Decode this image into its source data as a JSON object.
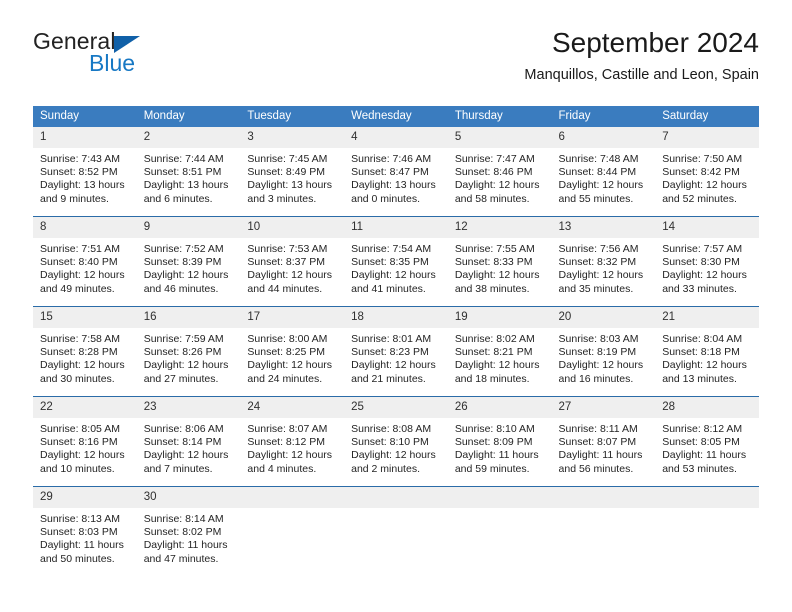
{
  "logo": {
    "word1": "General",
    "word2": "Blue",
    "triangle_color": "#1060a8",
    "blue_color": "#1778c4"
  },
  "header": {
    "title": "September 2024",
    "subtitle": "Manquillos, Castille and Leon, Spain"
  },
  "theme": {
    "header_bg": "#3a7cbf",
    "row_border": "#2b6ca8",
    "daynum_bg": "#efefef"
  },
  "calendar": {
    "weekday_headers": [
      "Sunday",
      "Monday",
      "Tuesday",
      "Wednesday",
      "Thursday",
      "Friday",
      "Saturday"
    ],
    "weeks": [
      [
        {
          "day": "1",
          "sunrise": "Sunrise: 7:43 AM",
          "sunset": "Sunset: 8:52 PM",
          "daylight1": "Daylight: 13 hours",
          "daylight2": "and 9 minutes."
        },
        {
          "day": "2",
          "sunrise": "Sunrise: 7:44 AM",
          "sunset": "Sunset: 8:51 PM",
          "daylight1": "Daylight: 13 hours",
          "daylight2": "and 6 minutes."
        },
        {
          "day": "3",
          "sunrise": "Sunrise: 7:45 AM",
          "sunset": "Sunset: 8:49 PM",
          "daylight1": "Daylight: 13 hours",
          "daylight2": "and 3 minutes."
        },
        {
          "day": "4",
          "sunrise": "Sunrise: 7:46 AM",
          "sunset": "Sunset: 8:47 PM",
          "daylight1": "Daylight: 13 hours",
          "daylight2": "and 0 minutes."
        },
        {
          "day": "5",
          "sunrise": "Sunrise: 7:47 AM",
          "sunset": "Sunset: 8:46 PM",
          "daylight1": "Daylight: 12 hours",
          "daylight2": "and 58 minutes."
        },
        {
          "day": "6",
          "sunrise": "Sunrise: 7:48 AM",
          "sunset": "Sunset: 8:44 PM",
          "daylight1": "Daylight: 12 hours",
          "daylight2": "and 55 minutes."
        },
        {
          "day": "7",
          "sunrise": "Sunrise: 7:50 AM",
          "sunset": "Sunset: 8:42 PM",
          "daylight1": "Daylight: 12 hours",
          "daylight2": "and 52 minutes."
        }
      ],
      [
        {
          "day": "8",
          "sunrise": "Sunrise: 7:51 AM",
          "sunset": "Sunset: 8:40 PM",
          "daylight1": "Daylight: 12 hours",
          "daylight2": "and 49 minutes."
        },
        {
          "day": "9",
          "sunrise": "Sunrise: 7:52 AM",
          "sunset": "Sunset: 8:39 PM",
          "daylight1": "Daylight: 12 hours",
          "daylight2": "and 46 minutes."
        },
        {
          "day": "10",
          "sunrise": "Sunrise: 7:53 AM",
          "sunset": "Sunset: 8:37 PM",
          "daylight1": "Daylight: 12 hours",
          "daylight2": "and 44 minutes."
        },
        {
          "day": "11",
          "sunrise": "Sunrise: 7:54 AM",
          "sunset": "Sunset: 8:35 PM",
          "daylight1": "Daylight: 12 hours",
          "daylight2": "and 41 minutes."
        },
        {
          "day": "12",
          "sunrise": "Sunrise: 7:55 AM",
          "sunset": "Sunset: 8:33 PM",
          "daylight1": "Daylight: 12 hours",
          "daylight2": "and 38 minutes."
        },
        {
          "day": "13",
          "sunrise": "Sunrise: 7:56 AM",
          "sunset": "Sunset: 8:32 PM",
          "daylight1": "Daylight: 12 hours",
          "daylight2": "and 35 minutes."
        },
        {
          "day": "14",
          "sunrise": "Sunrise: 7:57 AM",
          "sunset": "Sunset: 8:30 PM",
          "daylight1": "Daylight: 12 hours",
          "daylight2": "and 33 minutes."
        }
      ],
      [
        {
          "day": "15",
          "sunrise": "Sunrise: 7:58 AM",
          "sunset": "Sunset: 8:28 PM",
          "daylight1": "Daylight: 12 hours",
          "daylight2": "and 30 minutes."
        },
        {
          "day": "16",
          "sunrise": "Sunrise: 7:59 AM",
          "sunset": "Sunset: 8:26 PM",
          "daylight1": "Daylight: 12 hours",
          "daylight2": "and 27 minutes."
        },
        {
          "day": "17",
          "sunrise": "Sunrise: 8:00 AM",
          "sunset": "Sunset: 8:25 PM",
          "daylight1": "Daylight: 12 hours",
          "daylight2": "and 24 minutes."
        },
        {
          "day": "18",
          "sunrise": "Sunrise: 8:01 AM",
          "sunset": "Sunset: 8:23 PM",
          "daylight1": "Daylight: 12 hours",
          "daylight2": "and 21 minutes."
        },
        {
          "day": "19",
          "sunrise": "Sunrise: 8:02 AM",
          "sunset": "Sunset: 8:21 PM",
          "daylight1": "Daylight: 12 hours",
          "daylight2": "and 18 minutes."
        },
        {
          "day": "20",
          "sunrise": "Sunrise: 8:03 AM",
          "sunset": "Sunset: 8:19 PM",
          "daylight1": "Daylight: 12 hours",
          "daylight2": "and 16 minutes."
        },
        {
          "day": "21",
          "sunrise": "Sunrise: 8:04 AM",
          "sunset": "Sunset: 8:18 PM",
          "daylight1": "Daylight: 12 hours",
          "daylight2": "and 13 minutes."
        }
      ],
      [
        {
          "day": "22",
          "sunrise": "Sunrise: 8:05 AM",
          "sunset": "Sunset: 8:16 PM",
          "daylight1": "Daylight: 12 hours",
          "daylight2": "and 10 minutes."
        },
        {
          "day": "23",
          "sunrise": "Sunrise: 8:06 AM",
          "sunset": "Sunset: 8:14 PM",
          "daylight1": "Daylight: 12 hours",
          "daylight2": "and 7 minutes."
        },
        {
          "day": "24",
          "sunrise": "Sunrise: 8:07 AM",
          "sunset": "Sunset: 8:12 PM",
          "daylight1": "Daylight: 12 hours",
          "daylight2": "and 4 minutes."
        },
        {
          "day": "25",
          "sunrise": "Sunrise: 8:08 AM",
          "sunset": "Sunset: 8:10 PM",
          "daylight1": "Daylight: 12 hours",
          "daylight2": "and 2 minutes."
        },
        {
          "day": "26",
          "sunrise": "Sunrise: 8:10 AM",
          "sunset": "Sunset: 8:09 PM",
          "daylight1": "Daylight: 11 hours",
          "daylight2": "and 59 minutes."
        },
        {
          "day": "27",
          "sunrise": "Sunrise: 8:11 AM",
          "sunset": "Sunset: 8:07 PM",
          "daylight1": "Daylight: 11 hours",
          "daylight2": "and 56 minutes."
        },
        {
          "day": "28",
          "sunrise": "Sunrise: 8:12 AM",
          "sunset": "Sunset: 8:05 PM",
          "daylight1": "Daylight: 11 hours",
          "daylight2": "and 53 minutes."
        }
      ],
      [
        {
          "day": "29",
          "sunrise": "Sunrise: 8:13 AM",
          "sunset": "Sunset: 8:03 PM",
          "daylight1": "Daylight: 11 hours",
          "daylight2": "and 50 minutes."
        },
        {
          "day": "30",
          "sunrise": "Sunrise: 8:14 AM",
          "sunset": "Sunset: 8:02 PM",
          "daylight1": "Daylight: 11 hours",
          "daylight2": "and 47 minutes."
        },
        {
          "day": "",
          "sunrise": "",
          "sunset": "",
          "daylight1": "",
          "daylight2": ""
        },
        {
          "day": "",
          "sunrise": "",
          "sunset": "",
          "daylight1": "",
          "daylight2": ""
        },
        {
          "day": "",
          "sunrise": "",
          "sunset": "",
          "daylight1": "",
          "daylight2": ""
        },
        {
          "day": "",
          "sunrise": "",
          "sunset": "",
          "daylight1": "",
          "daylight2": ""
        },
        {
          "day": "",
          "sunrise": "",
          "sunset": "",
          "daylight1": "",
          "daylight2": ""
        }
      ]
    ]
  }
}
